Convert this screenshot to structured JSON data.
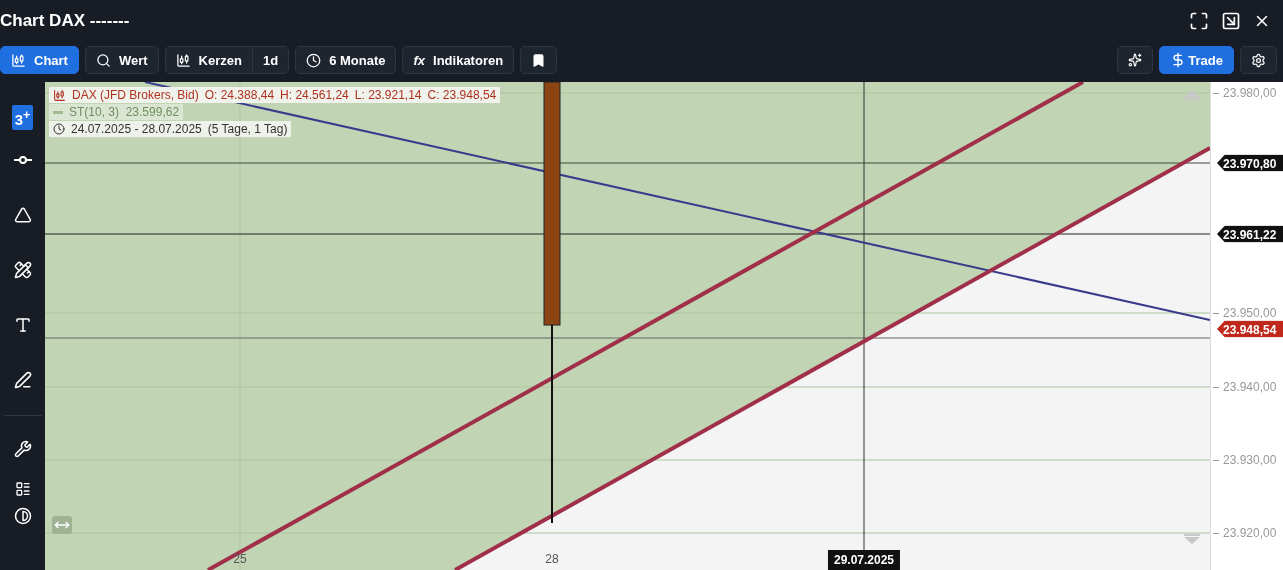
{
  "window": {
    "title": "Chart DAX -------"
  },
  "toolbar": {
    "left": [
      {
        "kind": "chart",
        "label": "Chart",
        "selected": true
      },
      {
        "kind": "search",
        "label": "Wert",
        "selected": false
      },
      {
        "kind": "candles",
        "label": "Kerzen",
        "interval": "1d"
      },
      {
        "kind": "period",
        "label": "6 Monate",
        "selected": false
      },
      {
        "kind": "indicators",
        "icon_text": "fx",
        "label": "Indikatoren",
        "selected": false
      },
      {
        "kind": "bookmark",
        "selected": false
      }
    ],
    "right": [
      {
        "kind": "sparkle"
      },
      {
        "kind": "trade",
        "label": "Trade"
      },
      {
        "kind": "settings"
      }
    ]
  },
  "sidebar": {
    "badge": "3$^{+}$"
  },
  "legend": {
    "symbol": "DAX (JFD Brokers, Bid)",
    "readings": [
      "O: 24.388,44",
      "H: 24.561,24",
      "L: 23.921,14",
      "C: 23.948,54"
    ],
    "indicator": "ST(10, 3)  23.599,62",
    "range": "24.07.2025 - 28.07.2025",
    "range_note": "(5 Tage, 1 Tag)"
  },
  "price_axis": {
    "ticks": [
      "23.980,00",
      "23.950,00",
      "23.940,00",
      "23.930,00",
      "23.920,00"
    ],
    "markers": [
      {
        "kind": "line",
        "label": "23.970,80"
      },
      {
        "kind": "line",
        "label": "23.961,22"
      },
      {
        "kind": "last",
        "label": "23.948,54"
      }
    ]
  },
  "time_axis": {
    "ticks": [
      "25",
      "28"
    ],
    "crosshair": "29.07.2025"
  }
}
